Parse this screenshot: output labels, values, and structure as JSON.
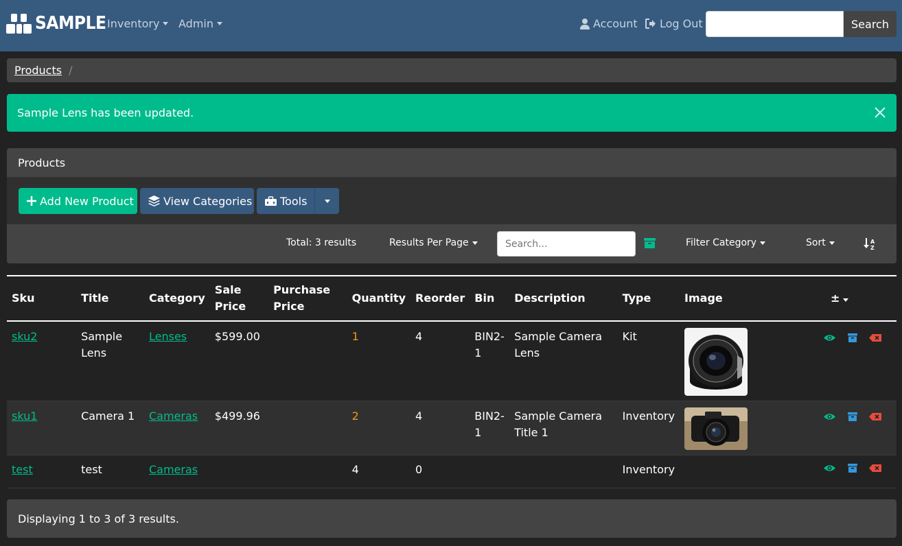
{
  "navbar": {
    "brand": "SAMPLE",
    "menu": [
      {
        "label": "Inventory"
      },
      {
        "label": "Admin"
      }
    ],
    "account_label": "Account",
    "logout_label": "Log Out",
    "search": {
      "value": "",
      "button_label": "Search"
    },
    "icons": {
      "brand": "boxes-logo-icon",
      "account": "user-icon",
      "logout": "sign-out-icon"
    }
  },
  "breadcrumb": {
    "items": [
      "Products"
    ],
    "separator": "/"
  },
  "alert": {
    "message": "Sample Lens has been updated.",
    "color": "#00bc8c",
    "close_icon": "close-icon"
  },
  "card": {
    "title": "Products",
    "buttons": {
      "add": "Add New Product",
      "categories": "View Categories",
      "tools": "Tools"
    },
    "toolbar": {
      "total": "Total: 3 results",
      "per_page": "Results Per Page",
      "search_placeholder": "Search...",
      "filter_category": "Filter Category",
      "sort": "Sort",
      "icons": {
        "archive": "archive-icon",
        "sort_dir": "sort-alpha-down-icon"
      }
    }
  },
  "table": {
    "headers": {
      "sku": "Sku",
      "title": "Title",
      "category": "Category",
      "sale_price": "Sale Price",
      "purchase_price": "Purchase Price",
      "quantity": "Quantity",
      "reorder": "Reorder",
      "bin": "Bin",
      "description": "Description",
      "type": "Type",
      "image": "Image",
      "columns_toggle": "±"
    },
    "rows": [
      {
        "sku": "sku2",
        "title": "Sample Lens",
        "category": "Lenses",
        "sale_price": "$599.00",
        "purchase_price": "",
        "quantity": "1",
        "quantity_low": true,
        "reorder": "4",
        "bin": "BIN2-1",
        "description": "Sample Camera Lens",
        "type": "Kit",
        "image": "camera-lens-photo"
      },
      {
        "sku": "sku1",
        "title": "Camera 1",
        "category": "Cameras",
        "sale_price": "$499.96",
        "purchase_price": "",
        "quantity": "2",
        "quantity_low": true,
        "reorder": "4",
        "bin": "BIN2-1",
        "description": "Sample Camera Title 1",
        "type": "Inventory",
        "image": "camera-photo"
      },
      {
        "sku": "test",
        "title": "test",
        "category": "Cameras",
        "sale_price": "",
        "purchase_price": "",
        "quantity": "4",
        "quantity_low": false,
        "reorder": "0",
        "bin": "",
        "description": "",
        "type": "Inventory",
        "image": ""
      }
    ],
    "row_actions": [
      "view-eye-icon",
      "archive-icon",
      "delete-icon"
    ]
  },
  "footer": {
    "text": "Displaying 1 to 3 of 3 results."
  },
  "colors": {
    "navbar": "#375a7f",
    "success": "#00bc8c",
    "primary": "#375a7f",
    "warning": "#f39c12",
    "danger": "#e74c3c",
    "info": "#3498db",
    "background": "#222222"
  }
}
